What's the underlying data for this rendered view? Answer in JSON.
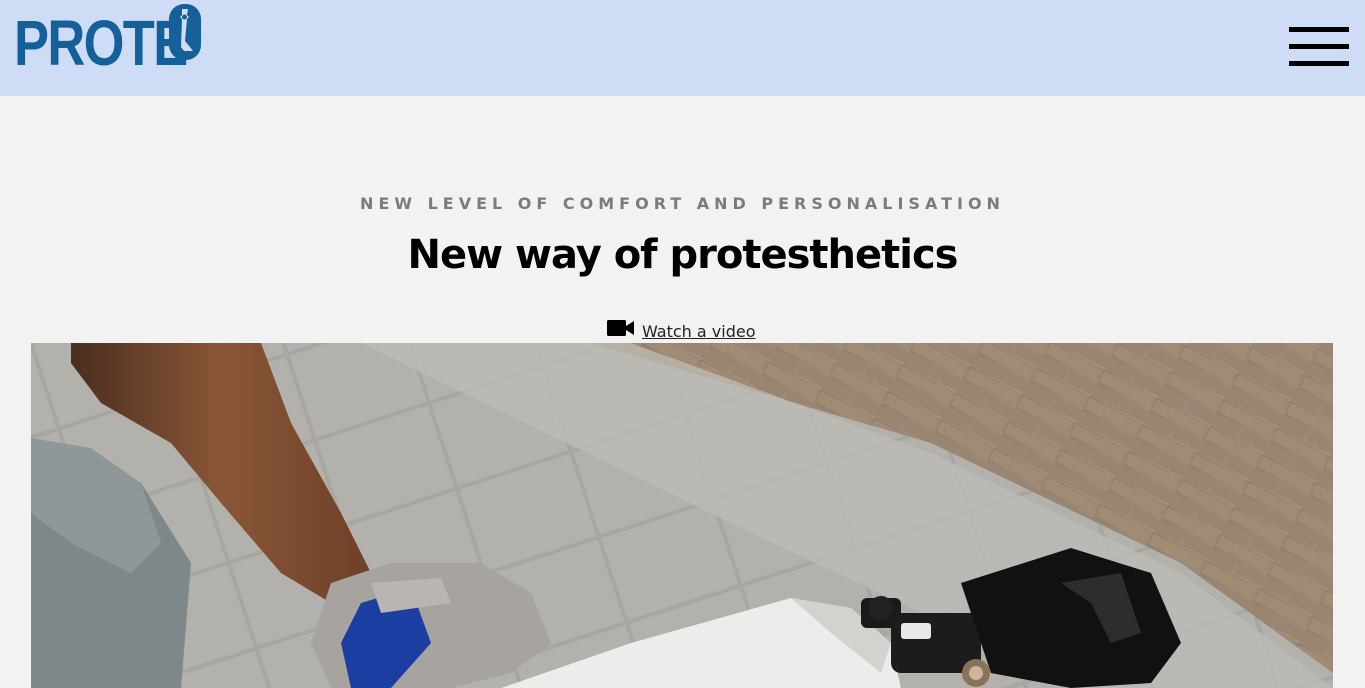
{
  "header": {
    "logo_text": "PROTE",
    "logo_alt": "PROTEO",
    "menu_icon": "hamburger-menu-icon",
    "background": "#cfdcf5",
    "brand_color": "#15609b"
  },
  "hero": {
    "kicker": "NEW LEVEL OF COMFORT AND PERSONALISATION",
    "title": "New way of protesthetics",
    "video_link": {
      "icon": "video-camera-icon",
      "label": "Watch a video"
    },
    "photo_subject": "person-with-prosthetic-leg-photo"
  }
}
